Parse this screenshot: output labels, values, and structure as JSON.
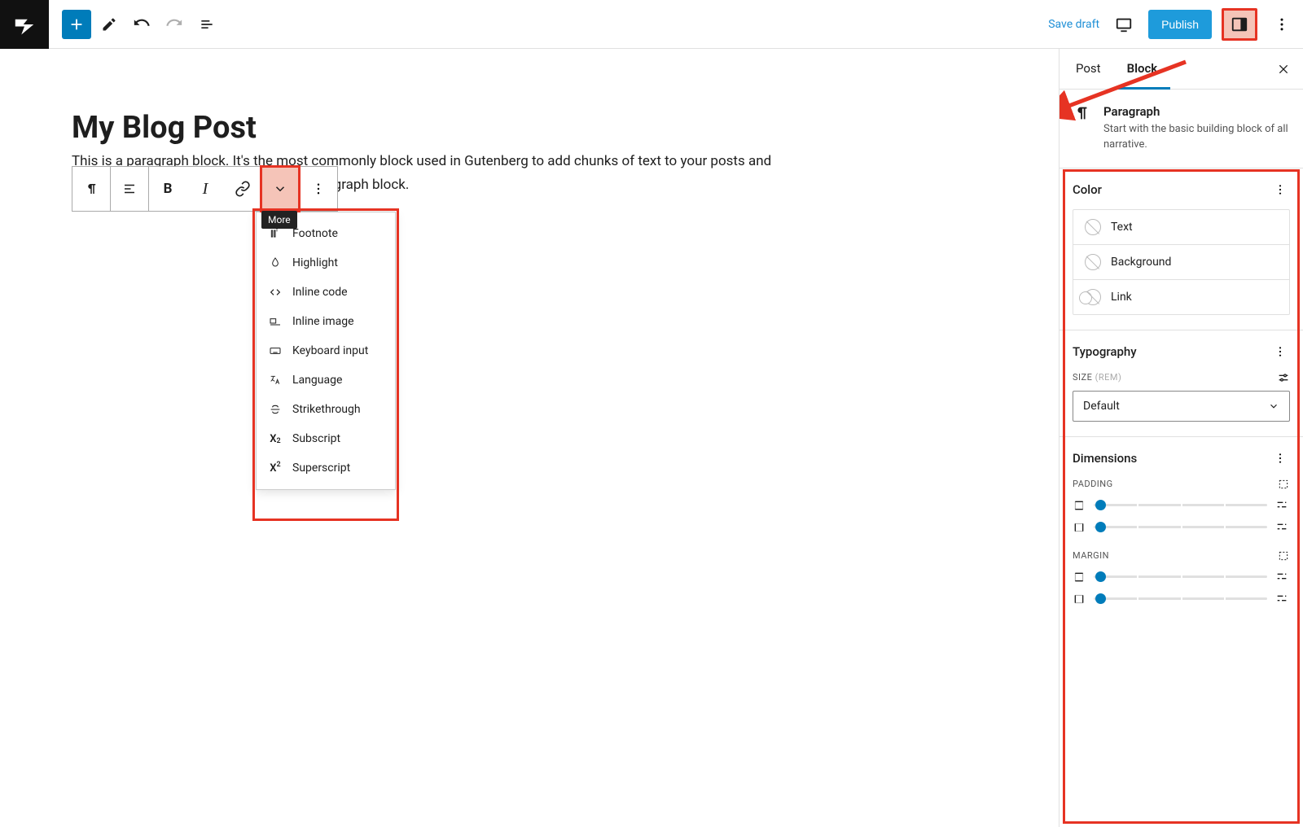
{
  "topbar": {
    "save_draft": "Save draft",
    "publish": "Publish"
  },
  "editor": {
    "post_title": "My Blog Post",
    "paragraph_text": "This is a paragraph block. It's the most commonly block used in Gutenberg to add chunks of text to your posts and pages. Just click enter to add another paragraph block."
  },
  "toolbar": {
    "more_tooltip": "More",
    "more_items": [
      {
        "label": "Footnote",
        "icon": "footnote-icon"
      },
      {
        "label": "Highlight",
        "icon": "highlight-icon"
      },
      {
        "label": "Inline code",
        "icon": "code-icon"
      },
      {
        "label": "Inline image",
        "icon": "inline-image-icon"
      },
      {
        "label": "Keyboard input",
        "icon": "keyboard-icon"
      },
      {
        "label": "Language",
        "icon": "language-icon"
      },
      {
        "label": "Strikethrough",
        "icon": "strikethrough-icon"
      },
      {
        "label": "Subscript",
        "icon": "subscript-icon"
      },
      {
        "label": "Superscript",
        "icon": "superscript-icon"
      }
    ]
  },
  "sidebar": {
    "tabs": {
      "post": "Post",
      "block": "Block"
    },
    "block_info": {
      "name": "Paragraph",
      "desc": "Start with the basic building block of all narrative."
    },
    "color": {
      "title": "Color",
      "rows": {
        "text": "Text",
        "background": "Background",
        "link": "Link"
      }
    },
    "typography": {
      "title": "Typography",
      "size_label": "SIZE",
      "size_unit": "(REM)",
      "size_value": "Default"
    },
    "dimensions": {
      "title": "Dimensions",
      "padding_label": "PADDING",
      "margin_label": "MARGIN"
    }
  }
}
